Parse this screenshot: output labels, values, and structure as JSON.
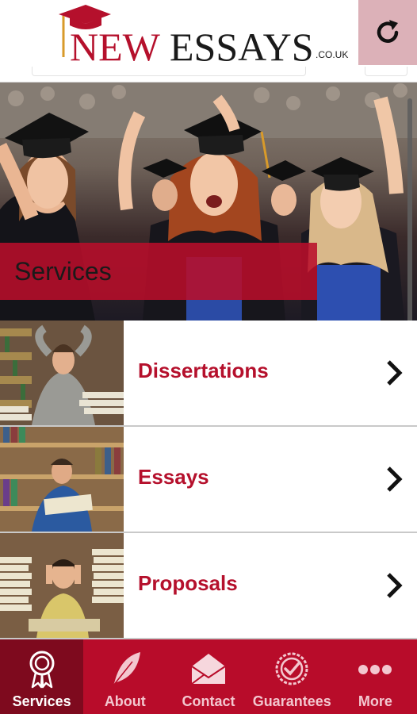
{
  "header": {
    "logo_new": "NEW",
    "logo_essays": "ESSAYS",
    "logo_domain": ".CO.UK",
    "refresh_icon": "refresh-icon"
  },
  "hero": {
    "banner_title": "Services"
  },
  "services": {
    "items": [
      {
        "label": "Dissertations",
        "thumb": "stressed-student-photo",
        "icon": "chevron-right-icon"
      },
      {
        "label": "Essays",
        "thumb": "student-reading-photo",
        "icon": "chevron-right-icon"
      },
      {
        "label": "Proposals",
        "thumb": "student-with-books-photo",
        "icon": "chevron-right-icon"
      }
    ]
  },
  "tabbar": {
    "tabs": [
      {
        "label": "Services",
        "icon": "rosette-icon",
        "active": true
      },
      {
        "label": "About",
        "icon": "feather-icon",
        "active": false
      },
      {
        "label": "Contact",
        "icon": "envelope-icon",
        "active": false
      },
      {
        "label": "Guarantees",
        "icon": "checkmark-seal-icon",
        "active": false
      },
      {
        "label": "More",
        "icon": "more-dots-icon",
        "active": false
      }
    ]
  },
  "colors": {
    "brand_red": "#b80c2a",
    "active_tab": "#7e0a1e",
    "label_red": "#b5102c",
    "refresh_bg": "#dcb1b8"
  }
}
